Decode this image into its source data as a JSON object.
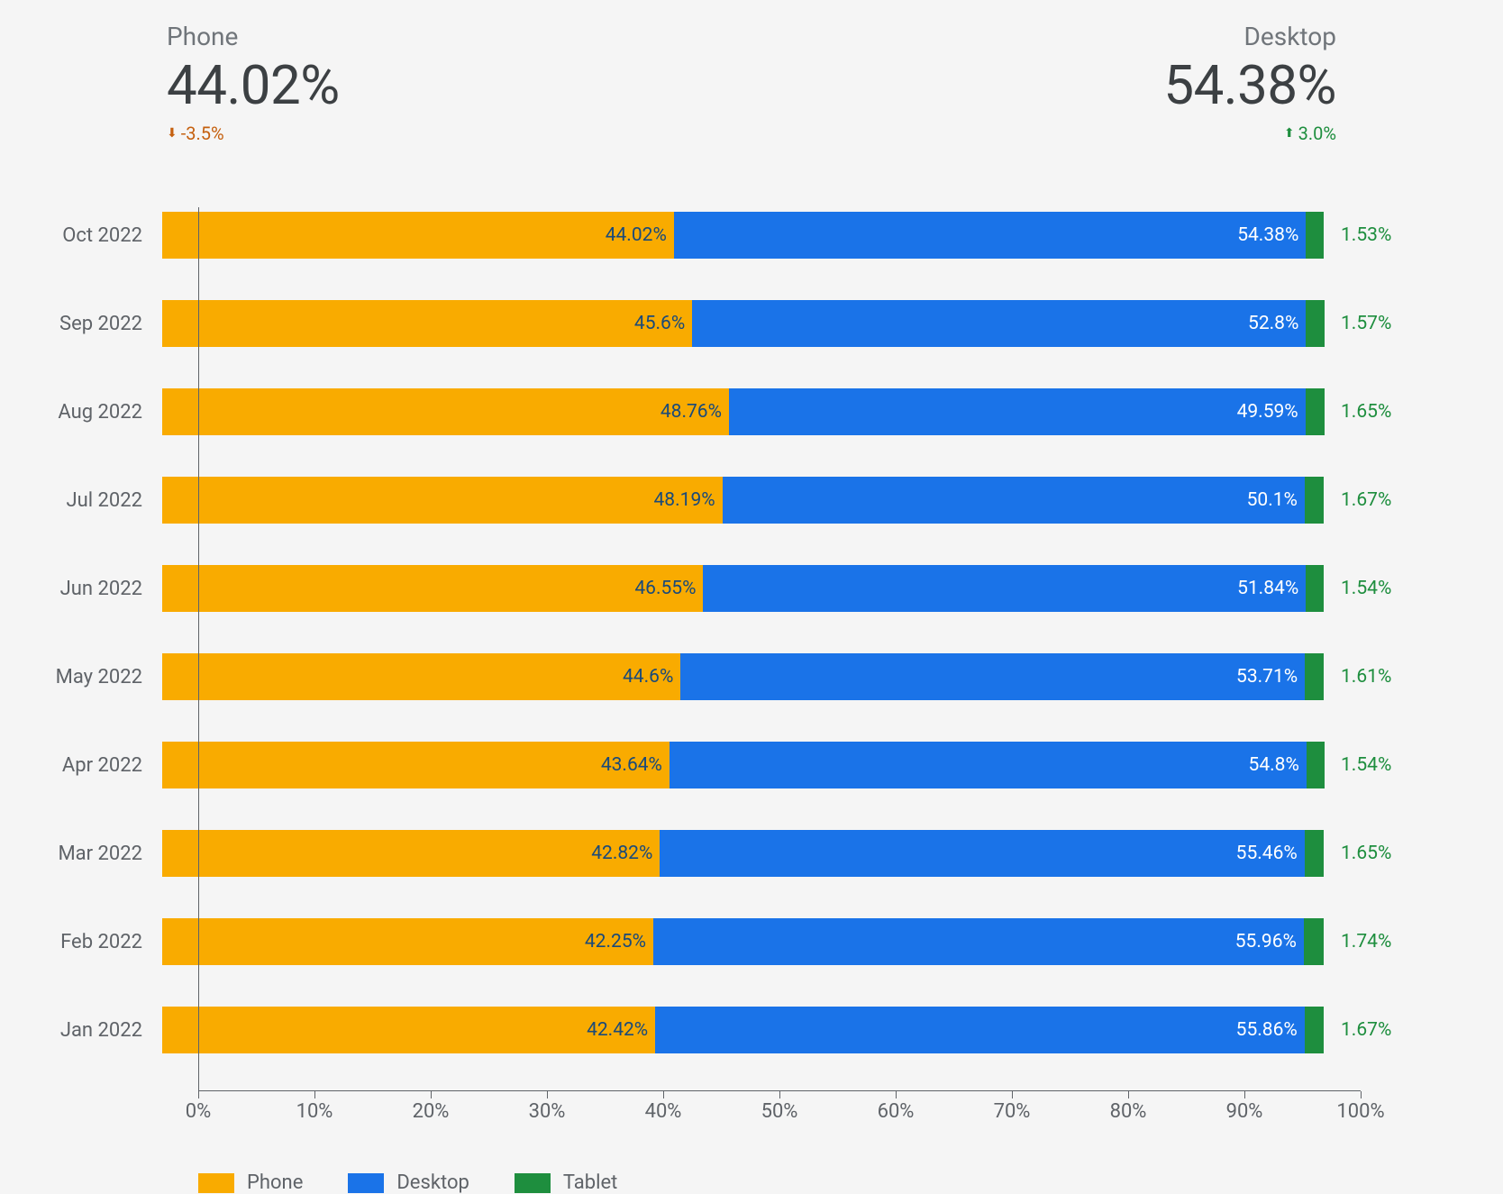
{
  "header": {
    "phone": {
      "label": "Phone",
      "value": "44.02%",
      "delta": "-3.5%",
      "dir": "down"
    },
    "desktop": {
      "label": "Desktop",
      "value": "54.38%",
      "delta": "3.0%",
      "dir": "up"
    }
  },
  "legend": {
    "phone": "Phone",
    "desktop": "Desktop",
    "tablet": "Tablet"
  },
  "xticks": [
    "0%",
    "10%",
    "20%",
    "30%",
    "40%",
    "50%",
    "60%",
    "70%",
    "80%",
    "90%",
    "100%"
  ],
  "chart_data": {
    "type": "bar",
    "stacked": true,
    "orientation": "horizontal",
    "xlabel": "",
    "ylabel": "",
    "xlim": [
      0,
      100
    ],
    "categories": [
      "Oct 2022",
      "Sep 2022",
      "Aug 2022",
      "Jul 2022",
      "Jun 2022",
      "May 2022",
      "Apr 2022",
      "Mar 2022",
      "Feb 2022",
      "Jan 2022"
    ],
    "series": [
      {
        "name": "Phone",
        "color": "#f9ab00",
        "values": [
          44.02,
          45.6,
          48.76,
          48.19,
          46.55,
          44.6,
          43.64,
          42.82,
          42.25,
          42.42
        ],
        "labels": [
          "44.02%",
          "45.6%",
          "48.76%",
          "48.19%",
          "46.55%",
          "44.6%",
          "43.64%",
          "42.82%",
          "42.25%",
          "42.42%"
        ]
      },
      {
        "name": "Desktop",
        "color": "#1a73e8",
        "values": [
          54.38,
          52.8,
          49.59,
          50.1,
          51.84,
          53.71,
          54.8,
          55.46,
          55.96,
          55.86
        ],
        "labels": [
          "54.38%",
          "52.8%",
          "49.59%",
          "50.1%",
          "51.84%",
          "53.71%",
          "54.8%",
          "55.46%",
          "55.96%",
          "55.86%"
        ]
      },
      {
        "name": "Tablet",
        "color": "#1e8e3e",
        "values": [
          1.53,
          1.57,
          1.65,
          1.67,
          1.54,
          1.61,
          1.54,
          1.65,
          1.74,
          1.67
        ],
        "labels": [
          "1.53%",
          "1.57%",
          "1.65%",
          "1.67%",
          "1.54%",
          "1.61%",
          "1.54%",
          "1.65%",
          "1.74%",
          "1.67%"
        ]
      }
    ]
  }
}
